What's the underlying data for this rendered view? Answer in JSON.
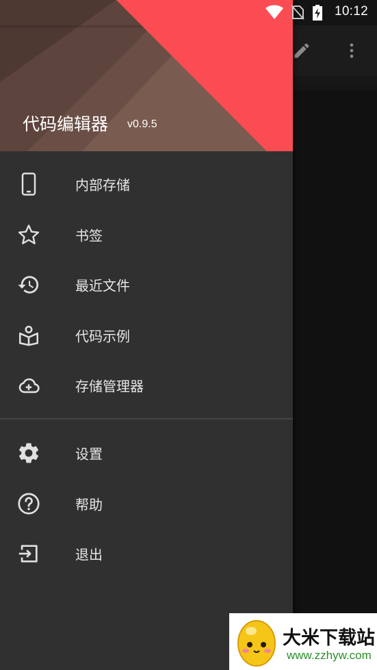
{
  "status_bar": {
    "time": "10:12",
    "icons": [
      "wifi-icon",
      "no-sim-icon",
      "battery-charging-icon"
    ]
  },
  "toolbar": {
    "icons": [
      "edit-icon",
      "more-vert-icon"
    ]
  },
  "drawer": {
    "header": {
      "title": "代码编辑器",
      "version": "v0.9.5"
    },
    "primary_items": [
      {
        "label": "内部存储",
        "icon": "phone-icon"
      },
      {
        "label": "书签",
        "icon": "star-outline-icon"
      },
      {
        "label": "最近文件",
        "icon": "history-icon"
      },
      {
        "label": "代码示例",
        "icon": "book-icon"
      },
      {
        "label": "存储管理器",
        "icon": "cloud-add-icon"
      }
    ],
    "secondary_items": [
      {
        "label": "设置",
        "icon": "gear-icon"
      },
      {
        "label": "帮助",
        "icon": "help-circle-icon"
      },
      {
        "label": "退出",
        "icon": "exit-icon"
      }
    ]
  },
  "watermark": {
    "name": "大米下载站",
    "url": "www.zzhyw.com"
  },
  "colors": {
    "drawer_bg": "#303030",
    "header_brown": "#6e5148",
    "header_red": "#fb4c53",
    "text_primary": "#e6e6e6",
    "icon": "#e0e0e0"
  }
}
